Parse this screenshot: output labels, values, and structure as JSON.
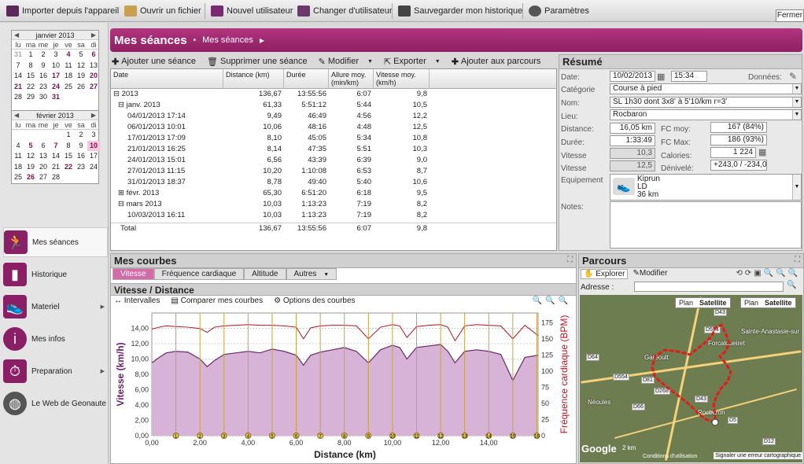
{
  "toolbar": {
    "items": [
      {
        "label": "Importer depuis l'appareil",
        "icon": "import-icon"
      },
      {
        "label": "Ouvrir un fichier",
        "icon": "open-folder-icon"
      },
      {
        "label": "Nouvel utilisateur",
        "icon": "add-user-icon"
      },
      {
        "label": "Changer d'utilisateur",
        "icon": "switch-user-icon"
      },
      {
        "label": "Sauvegarder mon historique",
        "icon": "save-icon"
      },
      {
        "label": "Paramètres",
        "icon": "gear-icon"
      }
    ],
    "close": "Fermer"
  },
  "calendars": [
    {
      "month": "janvier 2013",
      "days": [
        "lu",
        "ma",
        "me",
        "je",
        "ve",
        "sa",
        "di"
      ],
      "cells": [
        "31",
        "1",
        "2",
        "3",
        "4",
        "5",
        "6",
        "7",
        "8",
        "9",
        "10",
        "11",
        "12",
        "13",
        "14",
        "15",
        "16",
        "17",
        "18",
        "19",
        "20",
        "21",
        "22",
        "23",
        "24",
        "25",
        "26",
        "27",
        "28",
        "29",
        "30",
        "31",
        "",
        "",
        "",
        ""
      ],
      "bold": [
        "4",
        "6",
        "17",
        "20",
        "21",
        "24",
        "27",
        "31"
      ]
    },
    {
      "month": "février 2013",
      "days": [
        "lu",
        "ma",
        "me",
        "je",
        "ve",
        "sa",
        "di"
      ],
      "cells": [
        "",
        "",
        "",
        "",
        "1",
        "2",
        "3",
        "4",
        "5",
        "6",
        "7",
        "8",
        "9",
        "10",
        "11",
        "12",
        "13",
        "14",
        "15",
        "16",
        "17",
        "18",
        "19",
        "20",
        "21",
        "22",
        "23",
        "24",
        "25",
        "26",
        "27",
        "28",
        "",
        "",
        ""
      ],
      "bold": [
        "5",
        "7",
        "10",
        "22",
        "26"
      ],
      "selected": "10"
    }
  ],
  "nav": [
    {
      "label": "Mes séances",
      "icon": "runner-icon",
      "active": true
    },
    {
      "label": "Historique",
      "icon": "bar-chart-icon"
    },
    {
      "label": "Materiel",
      "icon": "shoe-icon",
      "arrow": true
    },
    {
      "label": "Mes infos",
      "icon": "info-icon"
    },
    {
      "label": "Preparation",
      "icon": "stopwatch-icon",
      "arrow": true
    },
    {
      "label": "Le Web de Geonaute",
      "icon": "globe-icon"
    }
  ],
  "header": {
    "title": "Mes séances",
    "crumb": "Mes séances"
  },
  "sessions": {
    "toolbar": [
      "Ajouter une séance",
      "Supprimer une séance",
      "Modifier",
      "Exporter",
      "Ajouter aux parcours"
    ],
    "columns": [
      "Date",
      "Distance (km)",
      "Durée",
      "Allure moy. (min/km)",
      "Vitesse moy. (km/h)"
    ],
    "rows": [
      {
        "date": "⊟ 2013",
        "dist": "136,67",
        "dur": "13:55:56",
        "allure": "6:07",
        "vit": "9,8",
        "indent": 0
      },
      {
        "date": "⊟ janv. 2013",
        "dist": "61,33",
        "dur": "5:51:12",
        "allure": "5:44",
        "vit": "10,5",
        "indent": 1
      },
      {
        "date": "04/01/2013 17:14",
        "dist": "9,49",
        "dur": "46:49",
        "allure": "4:56",
        "vit": "12,2",
        "indent": 3
      },
      {
        "date": "06/01/2013 10:01",
        "dist": "10,06",
        "dur": "48:16",
        "allure": "4:48",
        "vit": "12,5",
        "indent": 3
      },
      {
        "date": "17/01/2013 17:09",
        "dist": "8,10",
        "dur": "45:05",
        "allure": "5:34",
        "vit": "10,8",
        "indent": 3
      },
      {
        "date": "21/01/2013 16:25",
        "dist": "8,14",
        "dur": "47:35",
        "allure": "5:51",
        "vit": "10,3",
        "indent": 3
      },
      {
        "date": "24/01/2013 15:01",
        "dist": "6,56",
        "dur": "43:39",
        "allure": "6:39",
        "vit": "9,0",
        "indent": 3
      },
      {
        "date": "27/01/2013 11:15",
        "dist": "10,20",
        "dur": "1:10:08",
        "allure": "6:53",
        "vit": "8,7",
        "indent": 3
      },
      {
        "date": "31/01/2013 18:37",
        "dist": "8,78",
        "dur": "49:40",
        "allure": "5:40",
        "vit": "10,6",
        "indent": 3
      },
      {
        "date": "⊞ févr. 2013",
        "dist": "65,30",
        "dur": "6:51:20",
        "allure": "6:18",
        "vit": "9,5",
        "indent": 1
      },
      {
        "date": "⊟ mars 2013",
        "dist": "10,03",
        "dur": "1:13:23",
        "allure": "7:19",
        "vit": "8,2",
        "indent": 1
      },
      {
        "date": "10/03/2013 16:11",
        "dist": "10,03",
        "dur": "1:13:23",
        "allure": "7:19",
        "vit": "8,2",
        "indent": 3
      }
    ],
    "total": {
      "date": "Total",
      "dist": "136,67",
      "dur": "13:55:56",
      "allure": "6:07",
      "vit": "9,8"
    }
  },
  "summary": {
    "title": "Résumé",
    "date_label": "Date:",
    "date": "10/02/2013",
    "time": "15:34",
    "donnees_label": "Données:",
    "categorie_label": "Catégorie",
    "categorie": "Course à pied",
    "nom_label": "Nom:",
    "nom": "SL 1h30 dont 3x8' à 5'10/km r=3'",
    "lieu_label": "Lieu:",
    "lieu": "Rocbaron",
    "distance_label": "Distance:",
    "distance": "16,05 km",
    "duree_label": "Durée:",
    "duree": "1:33:49",
    "vitesse_label": "Vitesse",
    "vitesse": "10,3",
    "vitesse2_label": "Vitesse",
    "vitesse2": "12,5",
    "fcmoy_label": "FC moy:",
    "fcmoy": "167 (84%)",
    "fcmax_label": "FC Max:",
    "fcmax": "186 (93%)",
    "calories_label": "Calories:",
    "calories": "1 224",
    "denivele_label": "Dénivelé:",
    "denivele": "+243,0 / -234,0",
    "equip_label": "Equipement",
    "equip_name": "Kiprun",
    "equip_model": "LD",
    "equip_km": "36 km",
    "notes_label": "Notes:"
  },
  "courbes": {
    "title": "Mes courbes",
    "tabs": [
      "Vitesse",
      "Fréquence cardiaque",
      "Altitude",
      "Autres"
    ],
    "plot_title": "Vitesse / Distance",
    "tools": [
      "Intervalles",
      "Comparer mes courbes",
      "Options des courbes"
    ]
  },
  "chart_data": {
    "type": "area",
    "xlabel": "Distance (km)",
    "ylabel": "Vitesse (km/h)",
    "y2label": "Fréquence cardiaque (BPM)",
    "xlim": [
      0,
      16.05
    ],
    "ylim": [
      0,
      16
    ],
    "y2lim": [
      0,
      190
    ],
    "xticks": [
      "0,00",
      "2,00",
      "4,00",
      "6,00",
      "8,00",
      "10,00",
      "12,00",
      "14,00"
    ],
    "yticks": [
      "0,00",
      "2,00",
      "4,00",
      "6,00",
      "8,00",
      "10,00",
      "12,00",
      "14,00"
    ],
    "y2ticks": [
      "0",
      "25",
      "50",
      "75",
      "100",
      "125",
      "150",
      "175"
    ],
    "lap_markers": [
      "1",
      "2",
      "3",
      "4",
      "5",
      "6",
      "7",
      "8",
      "9",
      "10",
      "11",
      "12",
      "13",
      "14",
      "15",
      "16"
    ],
    "series": [
      {
        "name": "Vitesse",
        "axis": "y",
        "color": "#6a2a6a",
        "x": [
          0,
          0.3,
          0.6,
          1.0,
          1.5,
          2.0,
          2.3,
          2.6,
          3.0,
          3.5,
          4.0,
          4.5,
          5.0,
          5.5,
          6.0,
          6.3,
          6.6,
          7.0,
          7.5,
          8.0,
          8.5,
          9.0,
          9.5,
          10.0,
          10.3,
          10.6,
          11.0,
          11.5,
          12.0,
          12.3,
          12.6,
          13.0,
          13.5,
          14.0,
          14.5,
          15.0,
          15.5,
          16.05
        ],
        "values": [
          9.5,
          10.2,
          10.8,
          11.0,
          10.9,
          10.0,
          9.0,
          9.8,
          10.6,
          10.8,
          11.0,
          10.8,
          11.3,
          11.0,
          10.5,
          9.2,
          10.5,
          10.9,
          11.2,
          11.5,
          11.0,
          9.5,
          11.2,
          11.8,
          11.5,
          10.0,
          11.5,
          11.7,
          11.9,
          11.0,
          9.5,
          11.0,
          11.2,
          11.0,
          10.6,
          7.2,
          10.2,
          10.5
        ]
      },
      {
        "name": "Fréquence cardiaque",
        "axis": "y2",
        "color": "#b3141e",
        "x": [
          0,
          0.3,
          0.6,
          1.0,
          1.5,
          2.0,
          2.3,
          2.6,
          3.0,
          3.5,
          4.0,
          4.5,
          5.0,
          5.5,
          6.0,
          6.3,
          6.6,
          7.0,
          7.5,
          8.0,
          8.5,
          9.0,
          9.5,
          10.0,
          10.3,
          10.6,
          11.0,
          11.5,
          12.0,
          12.3,
          12.6,
          13.0,
          13.5,
          14.0,
          14.5,
          15.0,
          15.5,
          16.05
        ],
        "values": [
          165,
          168,
          170,
          169,
          168,
          166,
          160,
          168,
          170,
          171,
          172,
          171,
          171,
          170,
          168,
          150,
          167,
          170,
          171,
          171,
          170,
          150,
          168,
          172,
          170,
          152,
          169,
          171,
          172,
          168,
          147,
          170,
          172,
          171,
          170,
          150,
          171,
          155
        ]
      }
    ]
  },
  "parcours": {
    "title": "Parcours",
    "explorer": "Explorer",
    "modifier": "Modifier",
    "adresse_label": "Adresse :",
    "plan": "Plan",
    "satellite": "Satellite",
    "google": "Google",
    "scale": "2 km",
    "report": "Signaler une erreur cartographique",
    "conditions": "Conditions d'utilisation",
    "roads": [
      "D43",
      "D554",
      "D64",
      "D554",
      "D81",
      "D268",
      "D43",
      "D5",
      "D12",
      "D66"
    ],
    "towns": [
      "Sainte-Anastasie-sur",
      "Garéoult",
      "Néoules",
      "Rocbaron",
      "Forcalqueiret"
    ]
  }
}
